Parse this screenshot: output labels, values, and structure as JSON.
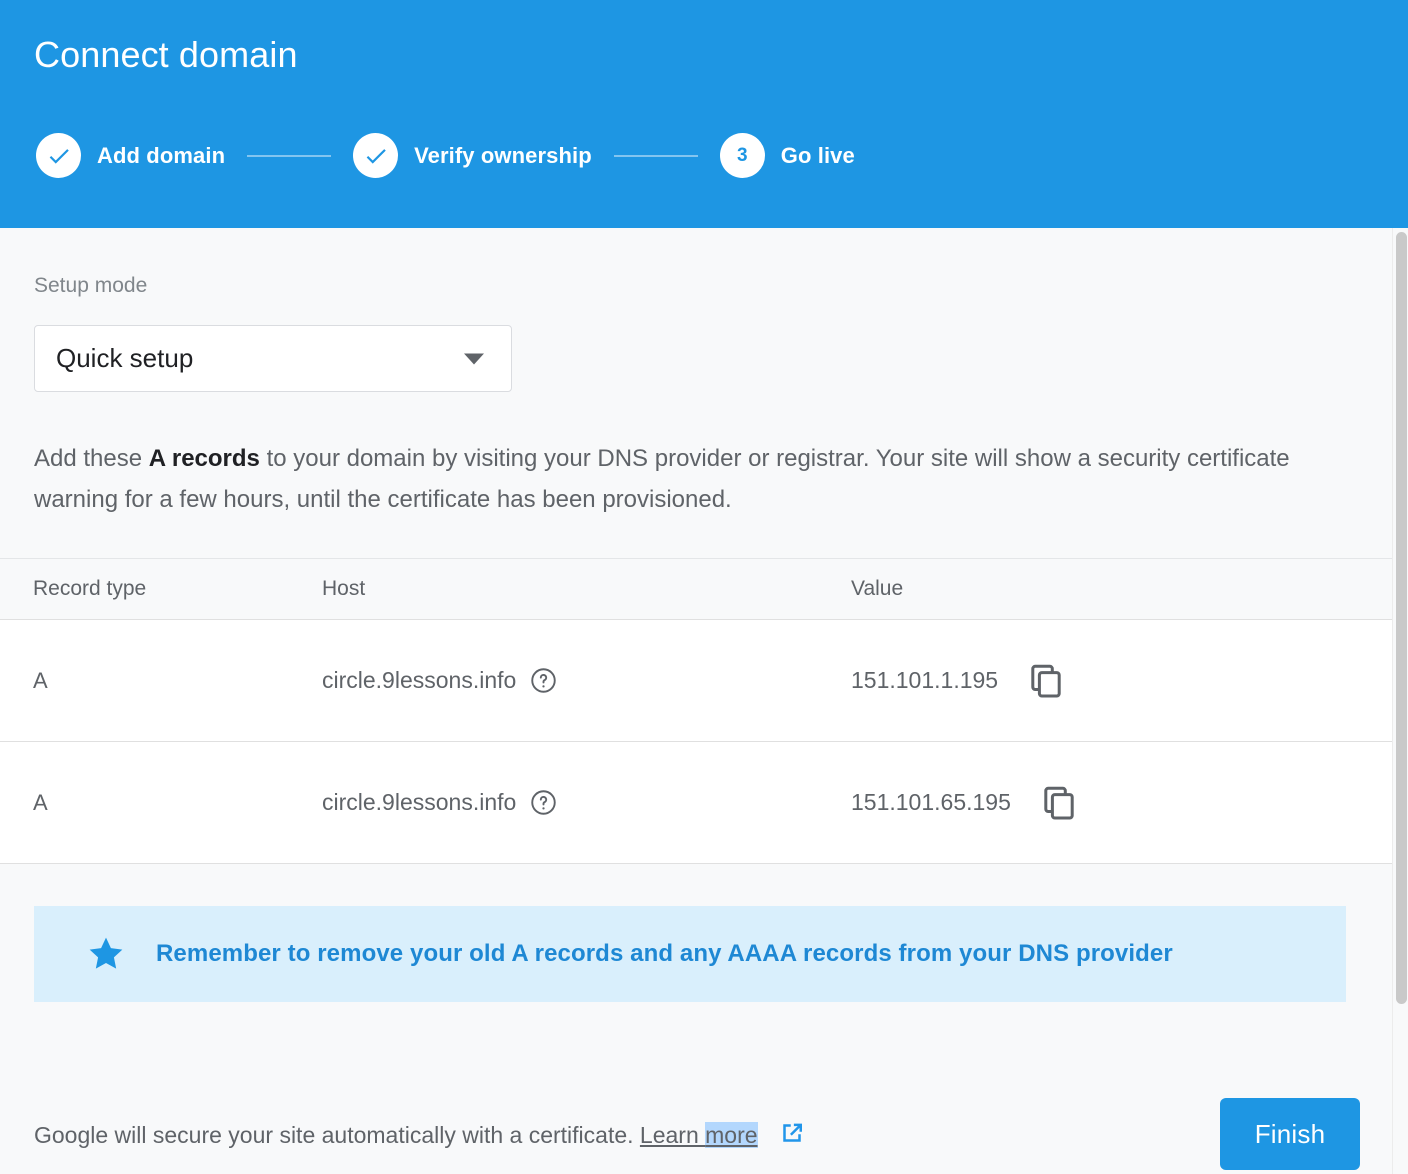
{
  "header": {
    "title": "Connect domain",
    "accent_color": "#1e96e3",
    "steps": [
      {
        "label": "Add domain",
        "state": "complete",
        "icon": "check-icon",
        "number": "1"
      },
      {
        "label": "Verify ownership",
        "state": "complete",
        "icon": "check-icon",
        "number": "2"
      },
      {
        "label": "Go live",
        "state": "current",
        "icon": "",
        "number": "3"
      }
    ]
  },
  "setup": {
    "label": "Setup mode",
    "selected": "Quick setup",
    "options": [
      "Quick setup"
    ],
    "chevron_icon": "chevron-down-icon"
  },
  "description": {
    "before": "Add these ",
    "bold": "A records",
    "after": " to your domain by visiting your DNS provider or registrar. Your site will show a security certificate warning for a few hours, until the certificate has been provisioned."
  },
  "table": {
    "columns": [
      "Record type",
      "Host",
      "Value"
    ],
    "rows": [
      {
        "record_type": "A",
        "host": "circle.9lessons.info",
        "host_help_icon": "help-circle-icon",
        "value": "151.101.1.195",
        "copy_icon": "copy-icon"
      },
      {
        "record_type": "A",
        "host": "circle.9lessons.info",
        "host_help_icon": "help-circle-icon",
        "value": "151.101.65.195",
        "copy_icon": "copy-icon"
      }
    ]
  },
  "banner": {
    "icon": "star-icon",
    "text": "Remember to remove your old A records and any AAAA records from your DNS provider",
    "background_color": "#d9effc",
    "text_color": "#1e88d4"
  },
  "footer": {
    "note": "Google will secure your site automatically with a certificate.",
    "link_text_plain": "Learn ",
    "link_text_selected": "more",
    "external_icon": "external-link-icon",
    "finish_label": "Finish"
  },
  "scrollbar": {
    "orientation": "vertical"
  }
}
